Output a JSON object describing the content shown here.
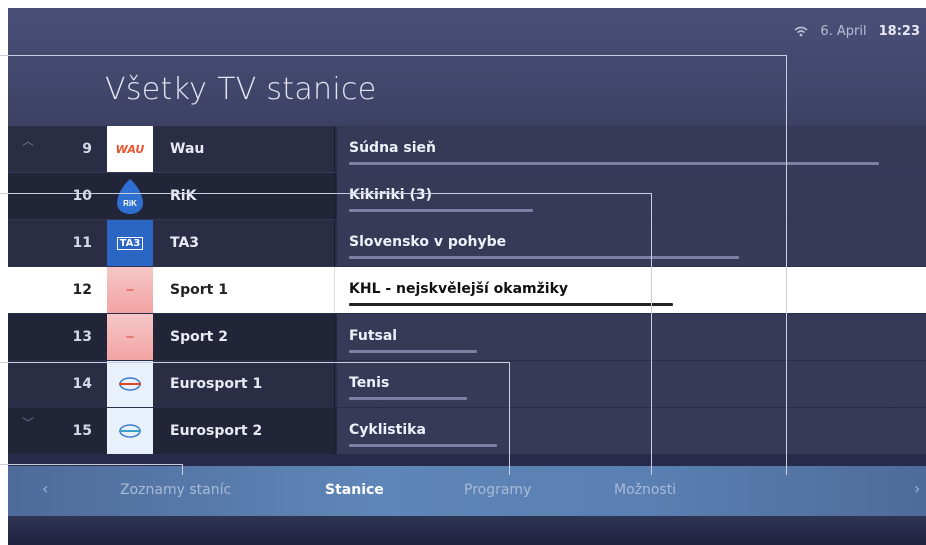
{
  "status": {
    "date": "6. April",
    "time": "18:23",
    "wifi_icon": "wifi-icon"
  },
  "title": "Všetky TV stanice",
  "channels": [
    {
      "number": "9",
      "logo": "WAU",
      "name": "Wau",
      "program": "Súdna sieň",
      "progress": 0.94
    },
    {
      "number": "10",
      "logo": "RiK",
      "name": "RiK",
      "program": "Kikiriki (3)",
      "progress": 0.33
    },
    {
      "number": "11",
      "logo": "TA3",
      "name": "TA3",
      "program": "Slovensko v pohybe",
      "progress": 0.69
    },
    {
      "number": "12",
      "logo": "sport1",
      "name": "Sport 1",
      "program": "KHL - nejskvělejší okamžiky",
      "progress": 0.56
    },
    {
      "number": "13",
      "logo": "sport2",
      "name": "Sport 2",
      "program": "Futsal",
      "progress": 0.22
    },
    {
      "number": "14",
      "logo": "eurosport",
      "name": "Eurosport 1",
      "program": "Tenis",
      "progress": 0.21
    },
    {
      "number": "15",
      "logo": "eurosport2",
      "name": "Eurosport 2",
      "program": "Cyklistika",
      "progress": 0.26
    }
  ],
  "tabs": [
    {
      "label": "Zoznamy staníc"
    },
    {
      "label": "Stanice"
    },
    {
      "label": "Programy"
    },
    {
      "label": "Možnosti"
    }
  ],
  "colors": {
    "selected_row": "#ffffff",
    "accent": "#5a7fb2"
  }
}
